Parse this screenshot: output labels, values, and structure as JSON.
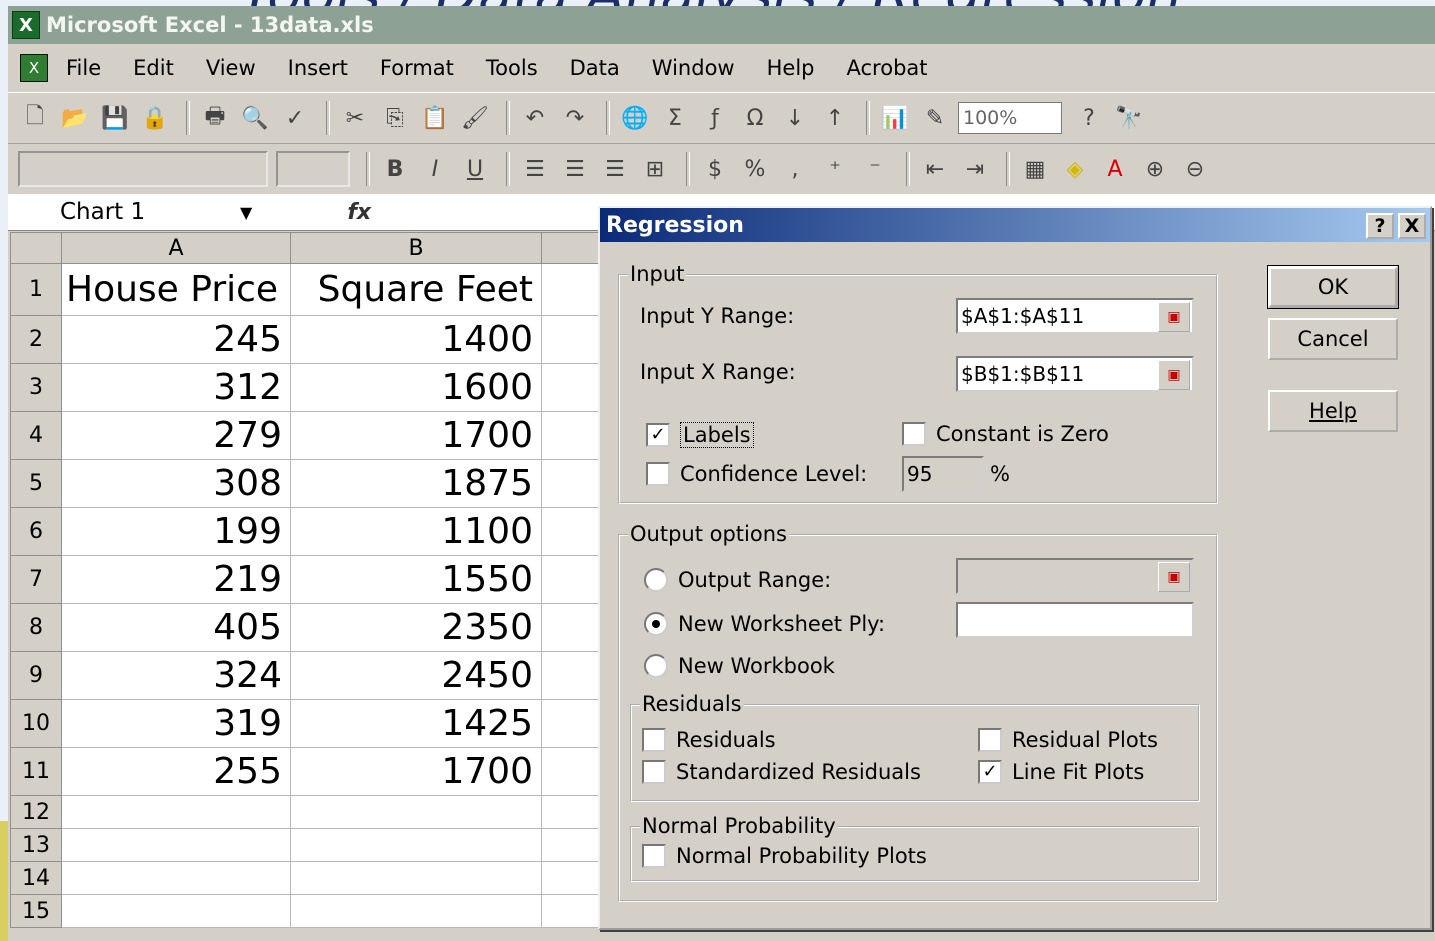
{
  "slide": {
    "title": "Tools / Data Analysis / Regression"
  },
  "app": {
    "title": "Microsoft Excel - 13data.xls"
  },
  "menu": [
    "File",
    "Edit",
    "View",
    "Insert",
    "Format",
    "Tools",
    "Data",
    "Window",
    "Help",
    "Acrobat"
  ],
  "toolbar": {
    "zoom": "100%"
  },
  "formula_bar": {
    "name_box": "Chart 1",
    "fx": "fx"
  },
  "sheet": {
    "columns": [
      "A",
      "B"
    ],
    "rows": [
      {
        "n": "1",
        "a": "House Price",
        "b": "Square Feet"
      },
      {
        "n": "2",
        "a": "245",
        "b": "1400"
      },
      {
        "n": "3",
        "a": "312",
        "b": "1600"
      },
      {
        "n": "4",
        "a": "279",
        "b": "1700"
      },
      {
        "n": "5",
        "a": "308",
        "b": "1875"
      },
      {
        "n": "6",
        "a": "199",
        "b": "1100"
      },
      {
        "n": "7",
        "a": "219",
        "b": "1550"
      },
      {
        "n": "8",
        "a": "405",
        "b": "2350"
      },
      {
        "n": "9",
        "a": "324",
        "b": "2450"
      },
      {
        "n": "10",
        "a": "319",
        "b": "1425"
      },
      {
        "n": "11",
        "a": "255",
        "b": "1700"
      },
      {
        "n": "12",
        "a": "",
        "b": ""
      },
      {
        "n": "13",
        "a": "",
        "b": ""
      },
      {
        "n": "14",
        "a": "",
        "b": ""
      },
      {
        "n": "15",
        "a": "",
        "b": ""
      }
    ]
  },
  "dialog": {
    "title": "Regression",
    "help_glyph": "?",
    "close_glyph": "X",
    "ok": "OK",
    "cancel": "Cancel",
    "help": "Help",
    "input_group": "Input",
    "input_y_label": "Input Y Range:",
    "input_y_value": "$A$1:$A$11",
    "input_x_label": "Input X Range:",
    "input_x_value": "$B$1:$B$11",
    "labels": "Labels",
    "labels_checked": true,
    "constant_zero": "Constant is Zero",
    "constant_zero_checked": false,
    "confidence": "Confidence Level:",
    "confidence_checked": false,
    "confidence_value": "95",
    "percent": "%",
    "output_group": "Output options",
    "output_range": "Output Range:",
    "new_ply": "New Worksheet Ply:",
    "new_workbook": "New Workbook",
    "selected_output": "new_ply",
    "residuals_group": "Residuals",
    "residuals": "Residuals",
    "residuals_checked": false,
    "std_residuals": "Standardized Residuals",
    "std_residuals_checked": false,
    "residual_plots": "Residual Plots",
    "residual_plots_checked": false,
    "line_fit": "Line Fit Plots",
    "line_fit_checked": true,
    "normal_group": "Normal Probability",
    "normal_plots": "Normal Probability Plots",
    "normal_plots_checked": false
  }
}
